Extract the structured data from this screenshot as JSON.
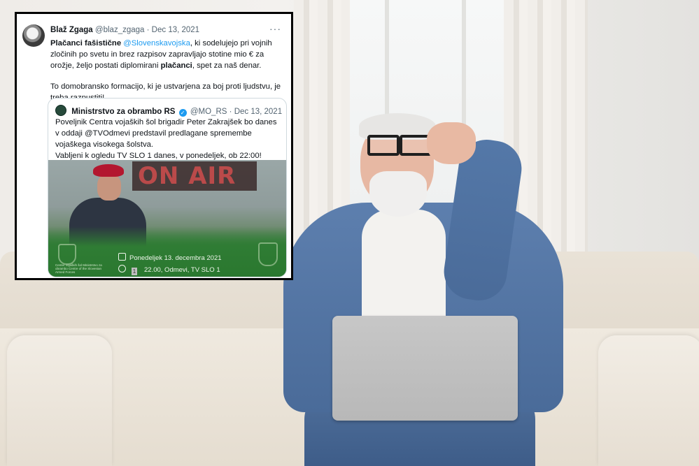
{
  "tweet": {
    "author_name": "Blaž Zgaga",
    "handle": "@blaz_zgaga",
    "date": "Dec 13, 2021",
    "more_label": "···",
    "text": {
      "p1_a": "Plačanci fašistične ",
      "p1_mention": "@Slovenskavojska",
      "p1_b": ", ki sodelujejo pri vojnih zločinih po svetu in brez razpisov zapravljajo stotine mio € za orožje, željo postati diplomirani ",
      "p1_bold": "plačanci",
      "p1_c": ", spet za naš denar.",
      "p2": "To domobransko formacijo, ki je ustvarjena za boj proti ljudstvu, je treba razpustiti!"
    },
    "quote": {
      "author_name": "Ministrstvo za obrambo RS",
      "verified_mark": "✓",
      "handle": "@MO_RS",
      "date": "Dec 13, 2021",
      "text_1": "Poveljnik Centra vojaških šol brigadir Peter Zakrajšek bo danes v oddaji @TVOdmevi predstavil predlagane spremembe vojaškega visokega šolstva.",
      "text_2": "Vabljeni k ogledu TV SLO 1 danes, v ponedeljek, ob 22:00!",
      "media": {
        "onair_text": "ON AIR",
        "event_date": "Ponedeljek 13. decembra 2021",
        "tv_channel_number": "1",
        "event_time": "22.00, Odmevi, TV SLO 1",
        "crest_caption": "Center vojaških šol Ministrstvo za obrambo Centre of the Slovenian Armed Forces"
      }
    }
  }
}
